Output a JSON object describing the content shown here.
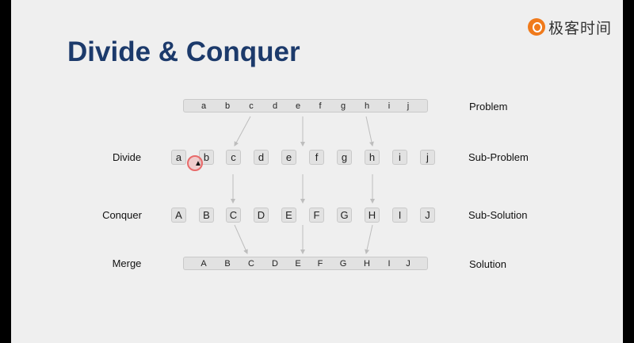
{
  "title": "Divide & Conquer",
  "logo": {
    "text": "极客时间",
    "icon": "geektime-logo-icon",
    "color": "#f07a1b"
  },
  "rows": {
    "problem": {
      "label": "",
      "side": "Problem",
      "items": [
        "a",
        "b",
        "c",
        "d",
        "e",
        "f",
        "g",
        "h",
        "i",
        "j"
      ]
    },
    "divide": {
      "label": "Divide",
      "side": "Sub-Problem",
      "items": [
        "a",
        "b",
        "c",
        "d",
        "e",
        "f",
        "g",
        "h",
        "i",
        "j"
      ]
    },
    "conquer": {
      "label": "Conquer",
      "side": "Sub-Solution",
      "items": [
        "A",
        "B",
        "C",
        "D",
        "E",
        "F",
        "G",
        "H",
        "I",
        "J"
      ]
    },
    "merge": {
      "label": "Merge",
      "side": "Solution",
      "items": [
        "A",
        "B",
        "C",
        "D",
        "E",
        "F",
        "G",
        "H",
        "I",
        "J"
      ]
    }
  },
  "colors": {
    "title": "#1c3a6b",
    "box_fill": "#e2e2e2",
    "box_border": "#c9c9c9",
    "arrow": "#bdbdbd",
    "cursor": "#e86a6a"
  }
}
